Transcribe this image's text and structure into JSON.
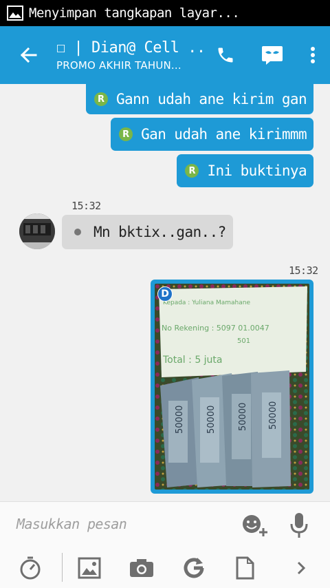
{
  "status_bar": {
    "text": "Menyimpan tangkapan layar...",
    "icon": "image-icon"
  },
  "app_bar": {
    "title": "☐ | Dian@ Cell ...",
    "subtitle": "PROMO AKHIR TAHUN...",
    "color": "#1e9ad6",
    "actions": [
      "back-arrow-icon",
      "phone-icon",
      "mask-icon",
      "more-vert-icon"
    ]
  },
  "messages": {
    "outgoing": [
      {
        "badge": "R",
        "text": "Gann udah ane kirim gan"
      },
      {
        "badge": "R",
        "text": "Gan udah ane kirimmm"
      },
      {
        "badge": "R",
        "text": "Ini buktinya"
      }
    ],
    "incoming": {
      "time": "15:32",
      "text": "Mn bktix..gan..?"
    },
    "image_message": {
      "time": "15:32",
      "badge": "D",
      "photo_text": {
        "kepada": "Kepada : Yuliana Mamahane",
        "rekening": "No Rekening : 5097 01.0047",
        "rekening2": "501",
        "total": "Total   : 5 juta"
      },
      "banknote_value": "50000"
    }
  },
  "composer": {
    "placeholder": "Masukkan pesan",
    "tools": [
      "timer-icon",
      "gallery-icon",
      "camera-icon",
      "refresh-g-icon",
      "document-icon",
      "chevron-right-icon"
    ]
  }
}
